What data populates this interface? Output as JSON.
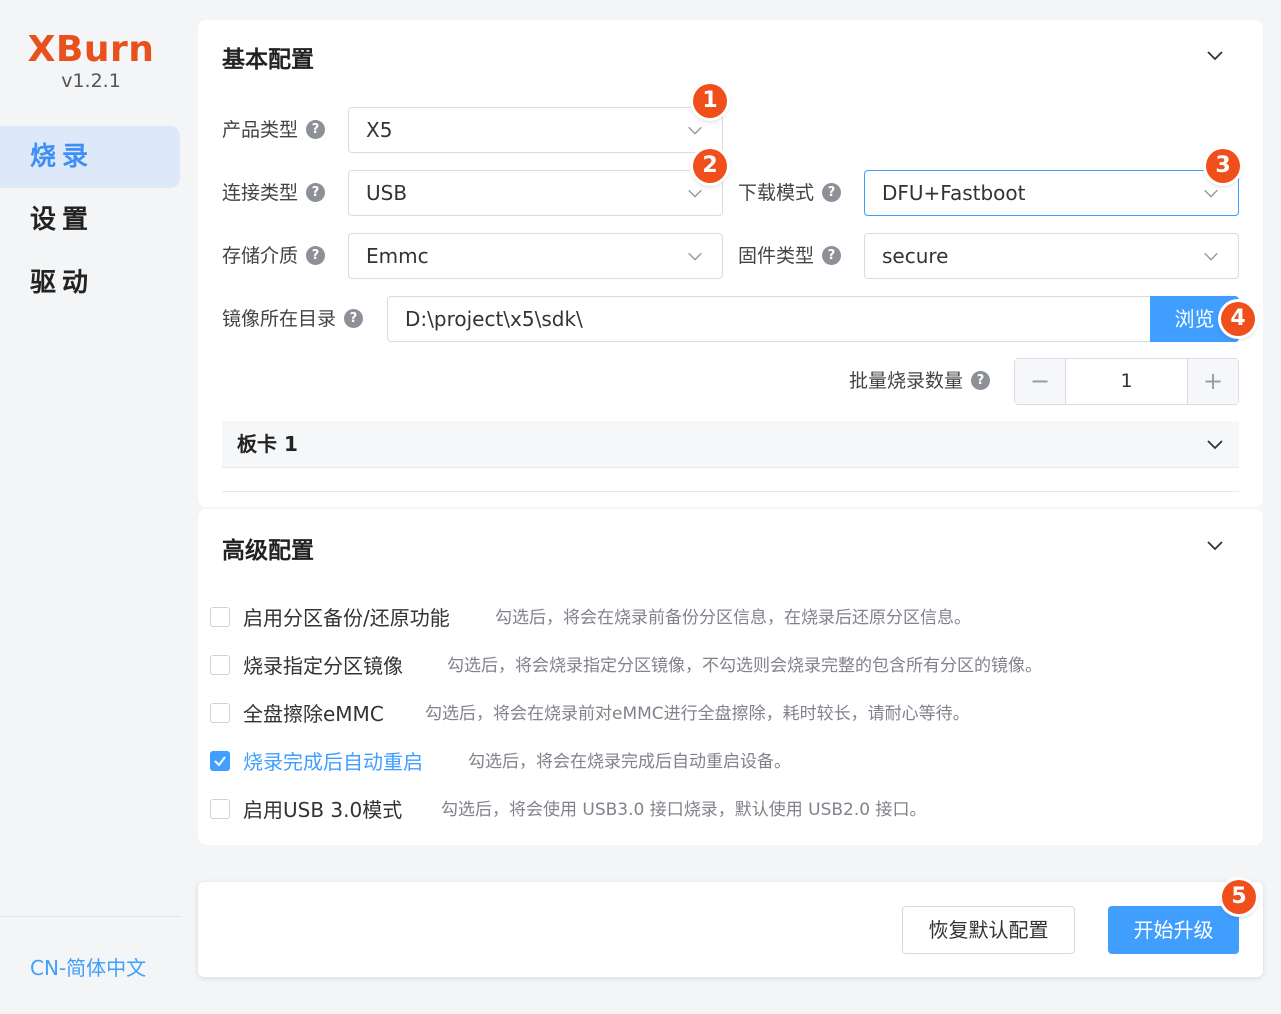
{
  "app": {
    "name": "XBurn",
    "version": "v1.2.1"
  },
  "nav": [
    {
      "label": "烧录",
      "active": true
    },
    {
      "label": "设置",
      "active": false
    },
    {
      "label": "驱动",
      "active": false
    }
  ],
  "language": "CN-简体中文",
  "basic": {
    "title": "基本配置",
    "product_type": {
      "label": "产品类型",
      "value": "X5"
    },
    "connect_type": {
      "label": "连接类型",
      "value": "USB"
    },
    "download_mode": {
      "label": "下载模式",
      "value": "DFU+Fastboot"
    },
    "storage": {
      "label": "存储介质",
      "value": "Emmc"
    },
    "firmware_type": {
      "label": "固件类型",
      "value": "secure"
    },
    "image_dir": {
      "label": "镜像所在目录",
      "value": "D:\\project\\x5\\sdk\\",
      "browse": "浏览"
    },
    "batch": {
      "label": "批量烧录数量",
      "value": "1",
      "minus": "−",
      "plus": "+"
    },
    "board": "板卡 1"
  },
  "advanced": {
    "title": "高级配置",
    "options": [
      {
        "label": "启用分区备份/还原功能",
        "desc": "勾选后，将会在烧录前备份分区信息，在烧录后还原分区信息。",
        "checked": false
      },
      {
        "label": "烧录指定分区镜像",
        "desc": "勾选后，将会烧录指定分区镜像，不勾选则会烧录完整的包含所有分区的镜像。",
        "checked": false
      },
      {
        "label": "全盘擦除eMMC",
        "desc": "勾选后，将会在烧录前对eMMC进行全盘擦除，耗时较长，请耐心等待。",
        "checked": false
      },
      {
        "label": "烧录完成后自动重启",
        "desc": "勾选后，将会在烧录完成后自动重启设备。",
        "checked": true
      },
      {
        "label": "启用USB 3.0模式",
        "desc": "勾选后，将会使用 USB3.0 接口烧录，默认使用 USB2.0 接口。",
        "checked": false
      }
    ]
  },
  "footer": {
    "reset": "恢复默认配置",
    "start": "开始升级"
  },
  "badges": [
    "1",
    "2",
    "3",
    "4",
    "5"
  ],
  "help_glyph": "?",
  "colors": {
    "accent": "#409eff",
    "brand": "#e8501e",
    "badge": "#f04e1b"
  }
}
